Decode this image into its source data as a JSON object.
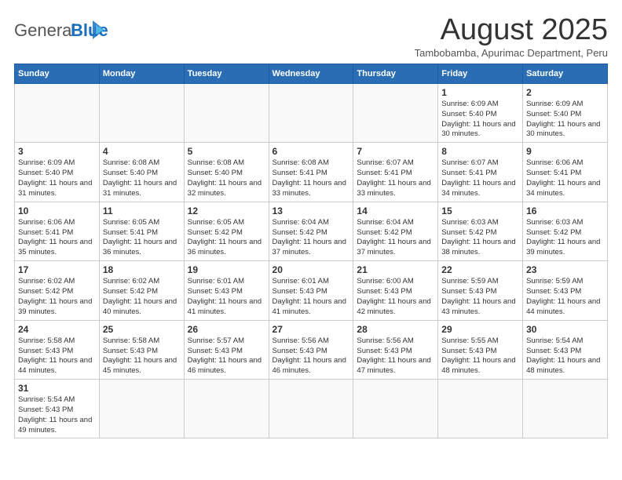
{
  "logo": {
    "general": "General",
    "blue": "Blue"
  },
  "header": {
    "month_year": "August 2025",
    "location": "Tambobamba, Apurimac Department, Peru"
  },
  "weekdays": [
    "Sunday",
    "Monday",
    "Tuesday",
    "Wednesday",
    "Thursday",
    "Friday",
    "Saturday"
  ],
  "weeks": [
    [
      {
        "day": "",
        "info": ""
      },
      {
        "day": "",
        "info": ""
      },
      {
        "day": "",
        "info": ""
      },
      {
        "day": "",
        "info": ""
      },
      {
        "day": "",
        "info": ""
      },
      {
        "day": "1",
        "info": "Sunrise: 6:09 AM\nSunset: 5:40 PM\nDaylight: 11 hours\nand 30 minutes."
      },
      {
        "day": "2",
        "info": "Sunrise: 6:09 AM\nSunset: 5:40 PM\nDaylight: 11 hours\nand 30 minutes."
      }
    ],
    [
      {
        "day": "3",
        "info": "Sunrise: 6:09 AM\nSunset: 5:40 PM\nDaylight: 11 hours\nand 31 minutes."
      },
      {
        "day": "4",
        "info": "Sunrise: 6:08 AM\nSunset: 5:40 PM\nDaylight: 11 hours\nand 31 minutes."
      },
      {
        "day": "5",
        "info": "Sunrise: 6:08 AM\nSunset: 5:40 PM\nDaylight: 11 hours\nand 32 minutes."
      },
      {
        "day": "6",
        "info": "Sunrise: 6:08 AM\nSunset: 5:41 PM\nDaylight: 11 hours\nand 33 minutes."
      },
      {
        "day": "7",
        "info": "Sunrise: 6:07 AM\nSunset: 5:41 PM\nDaylight: 11 hours\nand 33 minutes."
      },
      {
        "day": "8",
        "info": "Sunrise: 6:07 AM\nSunset: 5:41 PM\nDaylight: 11 hours\nand 34 minutes."
      },
      {
        "day": "9",
        "info": "Sunrise: 6:06 AM\nSunset: 5:41 PM\nDaylight: 11 hours\nand 34 minutes."
      }
    ],
    [
      {
        "day": "10",
        "info": "Sunrise: 6:06 AM\nSunset: 5:41 PM\nDaylight: 11 hours\nand 35 minutes."
      },
      {
        "day": "11",
        "info": "Sunrise: 6:05 AM\nSunset: 5:41 PM\nDaylight: 11 hours\nand 36 minutes."
      },
      {
        "day": "12",
        "info": "Sunrise: 6:05 AM\nSunset: 5:42 PM\nDaylight: 11 hours\nand 36 minutes."
      },
      {
        "day": "13",
        "info": "Sunrise: 6:04 AM\nSunset: 5:42 PM\nDaylight: 11 hours\nand 37 minutes."
      },
      {
        "day": "14",
        "info": "Sunrise: 6:04 AM\nSunset: 5:42 PM\nDaylight: 11 hours\nand 37 minutes."
      },
      {
        "day": "15",
        "info": "Sunrise: 6:03 AM\nSunset: 5:42 PM\nDaylight: 11 hours\nand 38 minutes."
      },
      {
        "day": "16",
        "info": "Sunrise: 6:03 AM\nSunset: 5:42 PM\nDaylight: 11 hours\nand 39 minutes."
      }
    ],
    [
      {
        "day": "17",
        "info": "Sunrise: 6:02 AM\nSunset: 5:42 PM\nDaylight: 11 hours\nand 39 minutes."
      },
      {
        "day": "18",
        "info": "Sunrise: 6:02 AM\nSunset: 5:42 PM\nDaylight: 11 hours\nand 40 minutes."
      },
      {
        "day": "19",
        "info": "Sunrise: 6:01 AM\nSunset: 5:43 PM\nDaylight: 11 hours\nand 41 minutes."
      },
      {
        "day": "20",
        "info": "Sunrise: 6:01 AM\nSunset: 5:43 PM\nDaylight: 11 hours\nand 41 minutes."
      },
      {
        "day": "21",
        "info": "Sunrise: 6:00 AM\nSunset: 5:43 PM\nDaylight: 11 hours\nand 42 minutes."
      },
      {
        "day": "22",
        "info": "Sunrise: 5:59 AM\nSunset: 5:43 PM\nDaylight: 11 hours\nand 43 minutes."
      },
      {
        "day": "23",
        "info": "Sunrise: 5:59 AM\nSunset: 5:43 PM\nDaylight: 11 hours\nand 44 minutes."
      }
    ],
    [
      {
        "day": "24",
        "info": "Sunrise: 5:58 AM\nSunset: 5:43 PM\nDaylight: 11 hours\nand 44 minutes."
      },
      {
        "day": "25",
        "info": "Sunrise: 5:58 AM\nSunset: 5:43 PM\nDaylight: 11 hours\nand 45 minutes."
      },
      {
        "day": "26",
        "info": "Sunrise: 5:57 AM\nSunset: 5:43 PM\nDaylight: 11 hours\nand 46 minutes."
      },
      {
        "day": "27",
        "info": "Sunrise: 5:56 AM\nSunset: 5:43 PM\nDaylight: 11 hours\nand 46 minutes."
      },
      {
        "day": "28",
        "info": "Sunrise: 5:56 AM\nSunset: 5:43 PM\nDaylight: 11 hours\nand 47 minutes."
      },
      {
        "day": "29",
        "info": "Sunrise: 5:55 AM\nSunset: 5:43 PM\nDaylight: 11 hours\nand 48 minutes."
      },
      {
        "day": "30",
        "info": "Sunrise: 5:54 AM\nSunset: 5:43 PM\nDaylight: 11 hours\nand 48 minutes."
      }
    ],
    [
      {
        "day": "31",
        "info": "Sunrise: 5:54 AM\nSunset: 5:43 PM\nDaylight: 11 hours\nand 49 minutes."
      },
      {
        "day": "",
        "info": ""
      },
      {
        "day": "",
        "info": ""
      },
      {
        "day": "",
        "info": ""
      },
      {
        "day": "",
        "info": ""
      },
      {
        "day": "",
        "info": ""
      },
      {
        "day": "",
        "info": ""
      }
    ]
  ]
}
